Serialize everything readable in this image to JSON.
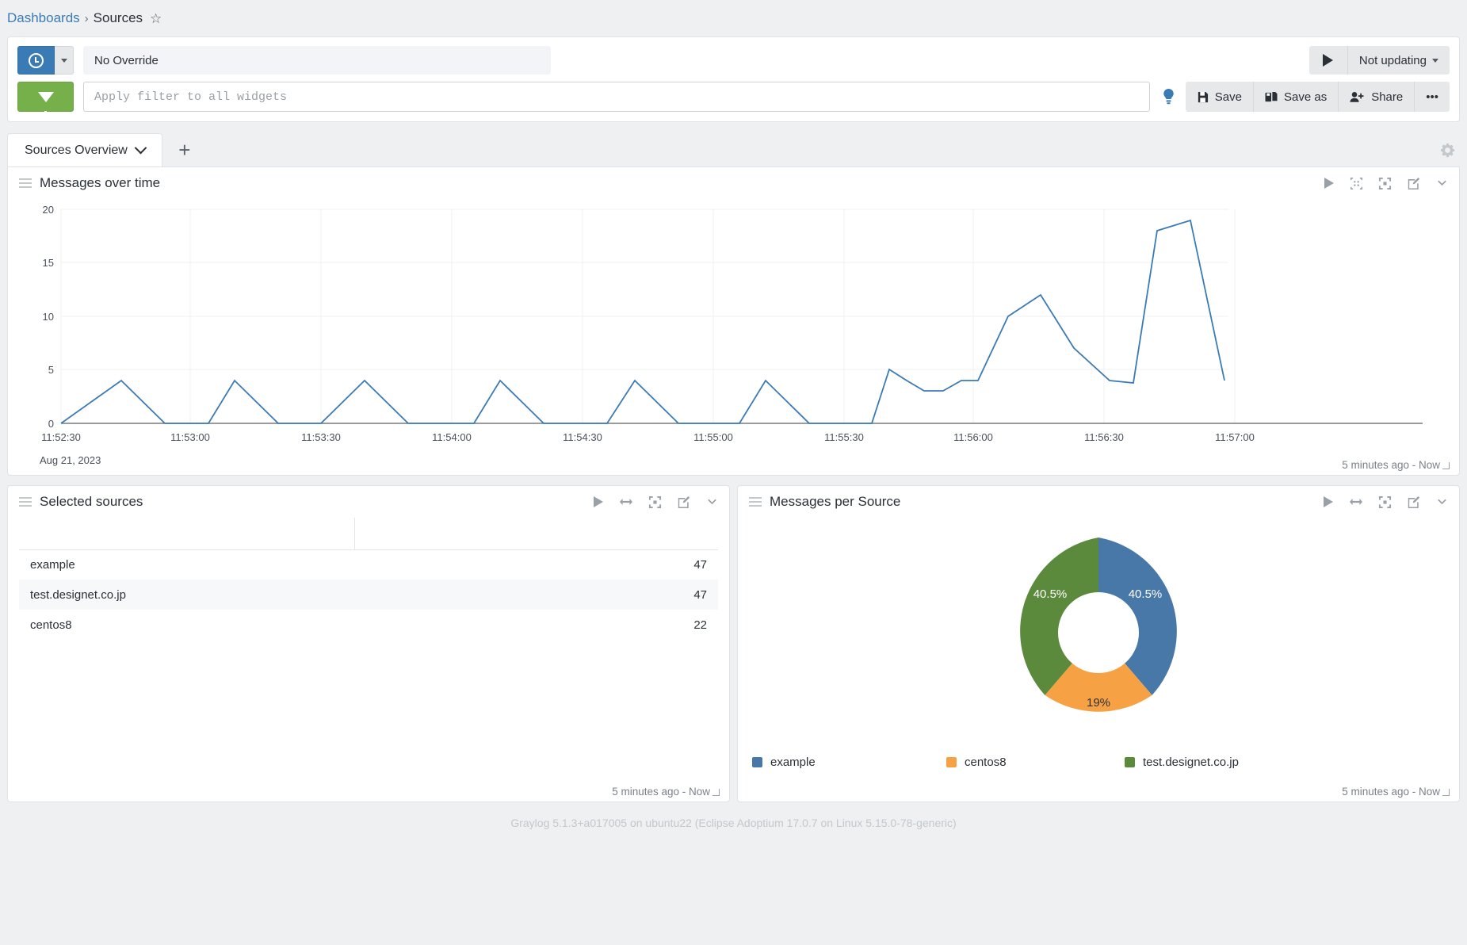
{
  "breadcrumb": {
    "root": "Dashboards",
    "separator": "›",
    "current": "Sources",
    "star_icon": "star-icon"
  },
  "toolbar": {
    "time_icon": "clock-icon",
    "time_override_value": "No Override",
    "filter_icon": "funnel-icon",
    "filter_placeholder": "Apply filter to all widgets",
    "bulb_icon": "lightbulb-icon",
    "play_icon": "play-icon",
    "update_label": "Not updating",
    "save_label": "Save",
    "save_as_label": "Save as",
    "share_label": "Share",
    "more_label": "•••"
  },
  "tabs": {
    "items": [
      {
        "label": "Sources Overview"
      }
    ],
    "add_label": "+",
    "gear_icon": "gear-icon"
  },
  "widgets": {
    "messages_over_time": {
      "title": "Messages over time",
      "footer": "5 minutes ago - Now",
      "actions": [
        "play-icon",
        "collapse-icon",
        "fullscreen-icon",
        "edit-icon",
        "chevron-down-icon"
      ]
    },
    "selected_sources": {
      "title": "Selected sources",
      "footer": "5 minutes ago - Now",
      "actions": [
        "play-icon",
        "resize-horizontal-icon",
        "fullscreen-icon",
        "edit-icon",
        "chevron-down-icon"
      ],
      "columns": [
        "",
        ""
      ],
      "rows": [
        {
          "source": "example",
          "count": "47"
        },
        {
          "source": "test.designet.co.jp",
          "count": "47"
        },
        {
          "source": "centos8",
          "count": "22"
        }
      ]
    },
    "messages_per_source": {
      "title": "Messages per Source",
      "footer": "5 minutes ago - Now",
      "actions": [
        "play-icon",
        "resize-horizontal-icon",
        "fullscreen-icon",
        "edit-icon",
        "chevron-down-icon"
      ]
    }
  },
  "chart_data": [
    {
      "type": "line",
      "title": "Messages over time",
      "xlabel": "",
      "ylabel": "",
      "date_label": "Aug 21, 2023",
      "ylim": [
        0,
        20
      ],
      "yticks": [
        0,
        5,
        10,
        15,
        20
      ],
      "xticks": [
        "11:52:30",
        "11:53:00",
        "11:53:30",
        "11:54:00",
        "11:54:30",
        "11:55:00",
        "11:55:30",
        "11:56:00",
        "11:56:30",
        "11:57:00"
      ],
      "grid": true,
      "line_color": "#3b7bb5",
      "x": [
        "11:52:30",
        "11:52:40",
        "11:52:50",
        "11:53:00",
        "11:53:05",
        "11:53:10",
        "11:53:20",
        "11:53:25",
        "11:53:30",
        "11:53:40",
        "11:53:50",
        "11:54:00",
        "11:54:05",
        "11:54:10",
        "11:54:20",
        "11:54:30",
        "11:54:40",
        "11:54:50",
        "11:55:00",
        "11:55:05",
        "11:55:10",
        "11:55:20",
        "11:55:25",
        "11:55:30",
        "11:55:40",
        "11:55:45",
        "11:55:50",
        "11:55:55",
        "11:56:00",
        "11:56:05",
        "11:56:10",
        "11:56:20",
        "11:56:30",
        "11:56:40",
        "11:56:50",
        "11:56:55",
        "11:57:00",
        "11:57:10",
        "11:57:20"
      ],
      "values": [
        0,
        4,
        0,
        0,
        0,
        4,
        0,
        0,
        0,
        4,
        0,
        0,
        0,
        4,
        0,
        0,
        0,
        4,
        0,
        0,
        0,
        4,
        0,
        0,
        0,
        5,
        4,
        3,
        3,
        4,
        4,
        10,
        12,
        7,
        4,
        4,
        18,
        19,
        5
      ]
    },
    {
      "type": "pie",
      "title": "Messages per Source",
      "donut": true,
      "labels": [
        "example",
        "centos8",
        "test.designet.co.jp"
      ],
      "values": [
        40.5,
        19,
        40.5
      ],
      "value_labels": [
        "40.5%",
        "19%",
        "40.5%"
      ],
      "colors": [
        "#4878a8",
        "#f7a145",
        "#5b8a3c"
      ],
      "legend_position": "bottom"
    }
  ],
  "footer_text": "Graylog 5.1.3+a017005 on ubuntu22 (Eclipse Adoptium 17.0.7 on Linux 5.15.0-78-generic)"
}
